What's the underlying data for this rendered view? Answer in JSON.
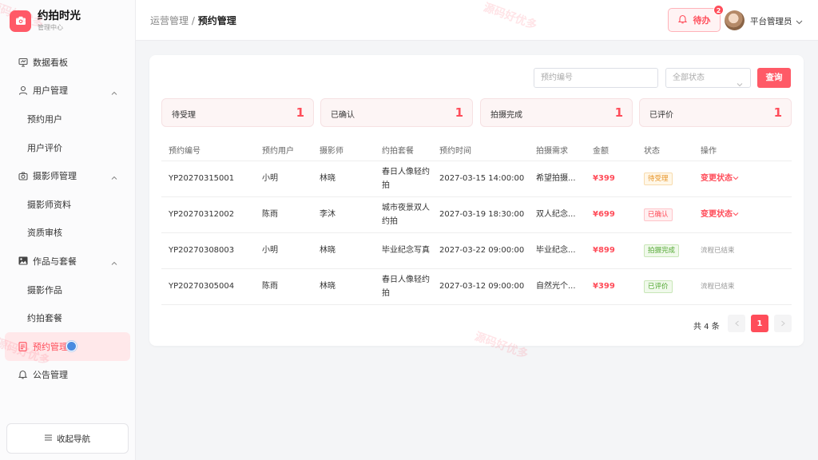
{
  "brand": {
    "title": "约拍时光",
    "subtitle": "管理中心"
  },
  "sidebar": {
    "items": [
      {
        "label": "数据看板",
        "icon": "dashboard-icon"
      },
      {
        "label": "用户管理",
        "icon": "user-icon",
        "expanded": true
      },
      {
        "label": "预约用户"
      },
      {
        "label": "用户评价"
      },
      {
        "label": "摄影师管理",
        "icon": "camera-icon",
        "expanded": true
      },
      {
        "label": "摄影师资料"
      },
      {
        "label": "资质审核"
      },
      {
        "label": "作品与套餐",
        "icon": "image-icon",
        "expanded": true
      },
      {
        "label": "摄影作品"
      },
      {
        "label": "约拍套餐"
      },
      {
        "label": "预约管理",
        "icon": "document-icon",
        "active": true
      },
      {
        "label": "公告管理",
        "icon": "bell-icon"
      }
    ],
    "collapse_label": "收起导航"
  },
  "header": {
    "breadcrumb_parent": "运营管理 /",
    "breadcrumb_current": "预约管理",
    "todo_label": "待办",
    "todo_count": "2",
    "admin_name": "平台管理员"
  },
  "filters": {
    "search_placeholder": "预约编号",
    "status_placeholder": "全部状态",
    "query_label": "查询"
  },
  "stats": [
    {
      "label": "待受理",
      "value": "1"
    },
    {
      "label": "已确认",
      "value": "1"
    },
    {
      "label": "拍摄完成",
      "value": "1"
    },
    {
      "label": "已评价",
      "value": "1"
    }
  ],
  "table": {
    "headers": [
      "预约编号",
      "预约用户",
      "摄影师",
      "约拍套餐",
      "预约时间",
      "拍摄需求",
      "金额",
      "状态",
      "操作"
    ],
    "rows": [
      {
        "id": "YP20270315001",
        "user": "小明",
        "photographer": "林晓",
        "package": "春日人像轻约拍",
        "time": "2027-03-15 14:00:00",
        "need": "希望拍摄...",
        "amount": "¥399",
        "status": "待受理",
        "action": "变更状态"
      },
      {
        "id": "YP20270312002",
        "user": "陈雨",
        "photographer": "李沐",
        "package": "城市夜景双人约拍",
        "time": "2027-03-19 18:30:00",
        "need": "双人纪念...",
        "amount": "¥699",
        "status": "已确认",
        "action": "变更状态"
      },
      {
        "id": "YP20270308003",
        "user": "小明",
        "photographer": "林晓",
        "package": "毕业纪念写真",
        "time": "2027-03-22 09:00:00",
        "need": "毕业纪念...",
        "amount": "¥899",
        "status": "拍摄完成",
        "action": "流程已结束"
      },
      {
        "id": "YP20270305004",
        "user": "陈雨",
        "photographer": "林晓",
        "package": "春日人像轻约拍",
        "time": "2027-03-12 09:00:00",
        "need": "自然光个...",
        "amount": "¥399",
        "status": "已评价",
        "action": "流程已结束"
      }
    ]
  },
  "pagination": {
    "total_text": "共 4 条",
    "current_page": "1"
  },
  "watermark": "源码好优多",
  "colors": {
    "accent": "#ff4d5a",
    "brand": "#ff5a67"
  }
}
